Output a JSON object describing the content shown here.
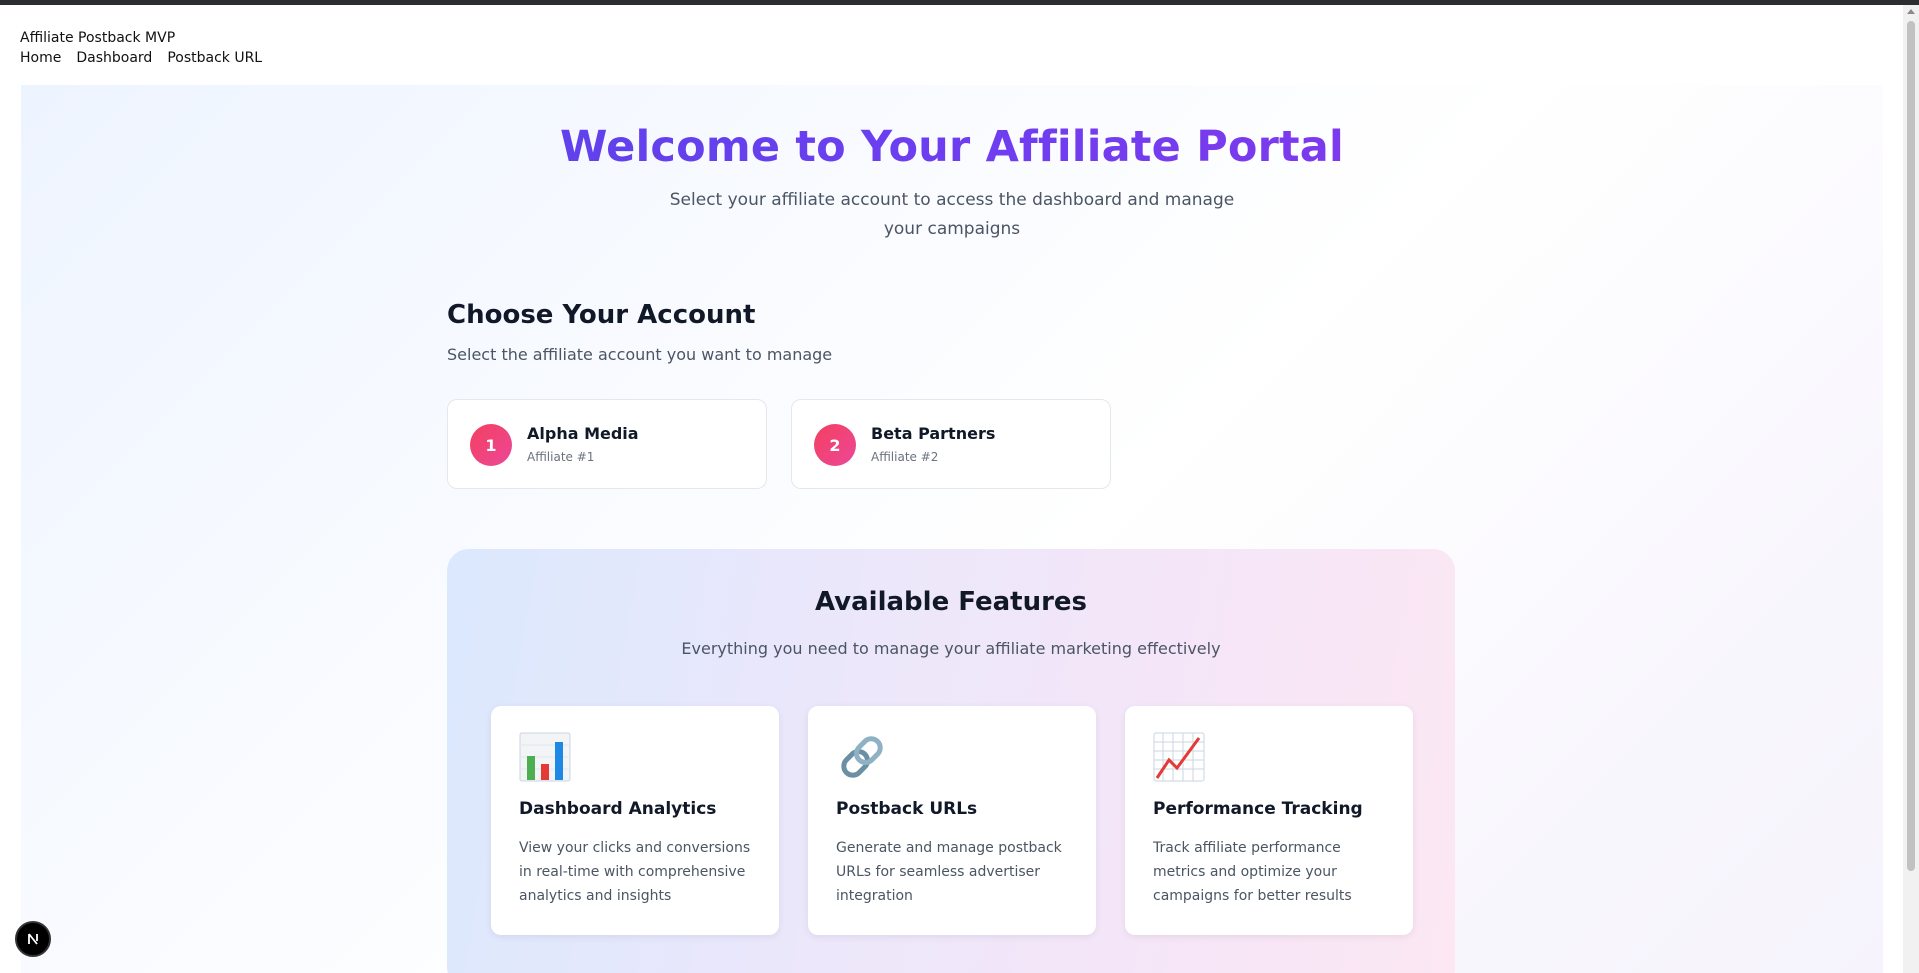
{
  "app": {
    "title": "Affiliate Postback MVP"
  },
  "nav": {
    "items": [
      "Home",
      "Dashboard",
      "Postback URL"
    ]
  },
  "hero": {
    "title": "Welcome to Your Affiliate Portal",
    "subtitle": "Select your affiliate account to access the dashboard and manage your campaigns"
  },
  "accounts_section": {
    "title": "Choose Your Account",
    "subtitle": "Select the affiliate account you want to manage",
    "accounts": [
      {
        "number": "1",
        "name": "Alpha Media",
        "label": "Affiliate #1"
      },
      {
        "number": "2",
        "name": "Beta Partners",
        "label": "Affiliate #2"
      }
    ]
  },
  "features_section": {
    "title": "Available Features",
    "subtitle": "Everything you need to manage your affiliate marketing effectively",
    "features": [
      {
        "icon": "bar-chart-icon",
        "title": "Dashboard Analytics",
        "description": "View your clicks and conversions in real-time with comprehensive analytics and insights"
      },
      {
        "icon": "link-icon",
        "title": "Postback URLs",
        "description": "Generate and manage postback URLs for seamless advertiser integration"
      },
      {
        "icon": "trending-up-icon",
        "title": "Performance Tracking",
        "description": "Track affiliate performance metrics and optimize your campaigns for better results"
      }
    ]
  },
  "colors": {
    "title_gradient_start": "#4f46e5",
    "title_gradient_end": "#9333ea",
    "account_badge": "#ec4899"
  }
}
